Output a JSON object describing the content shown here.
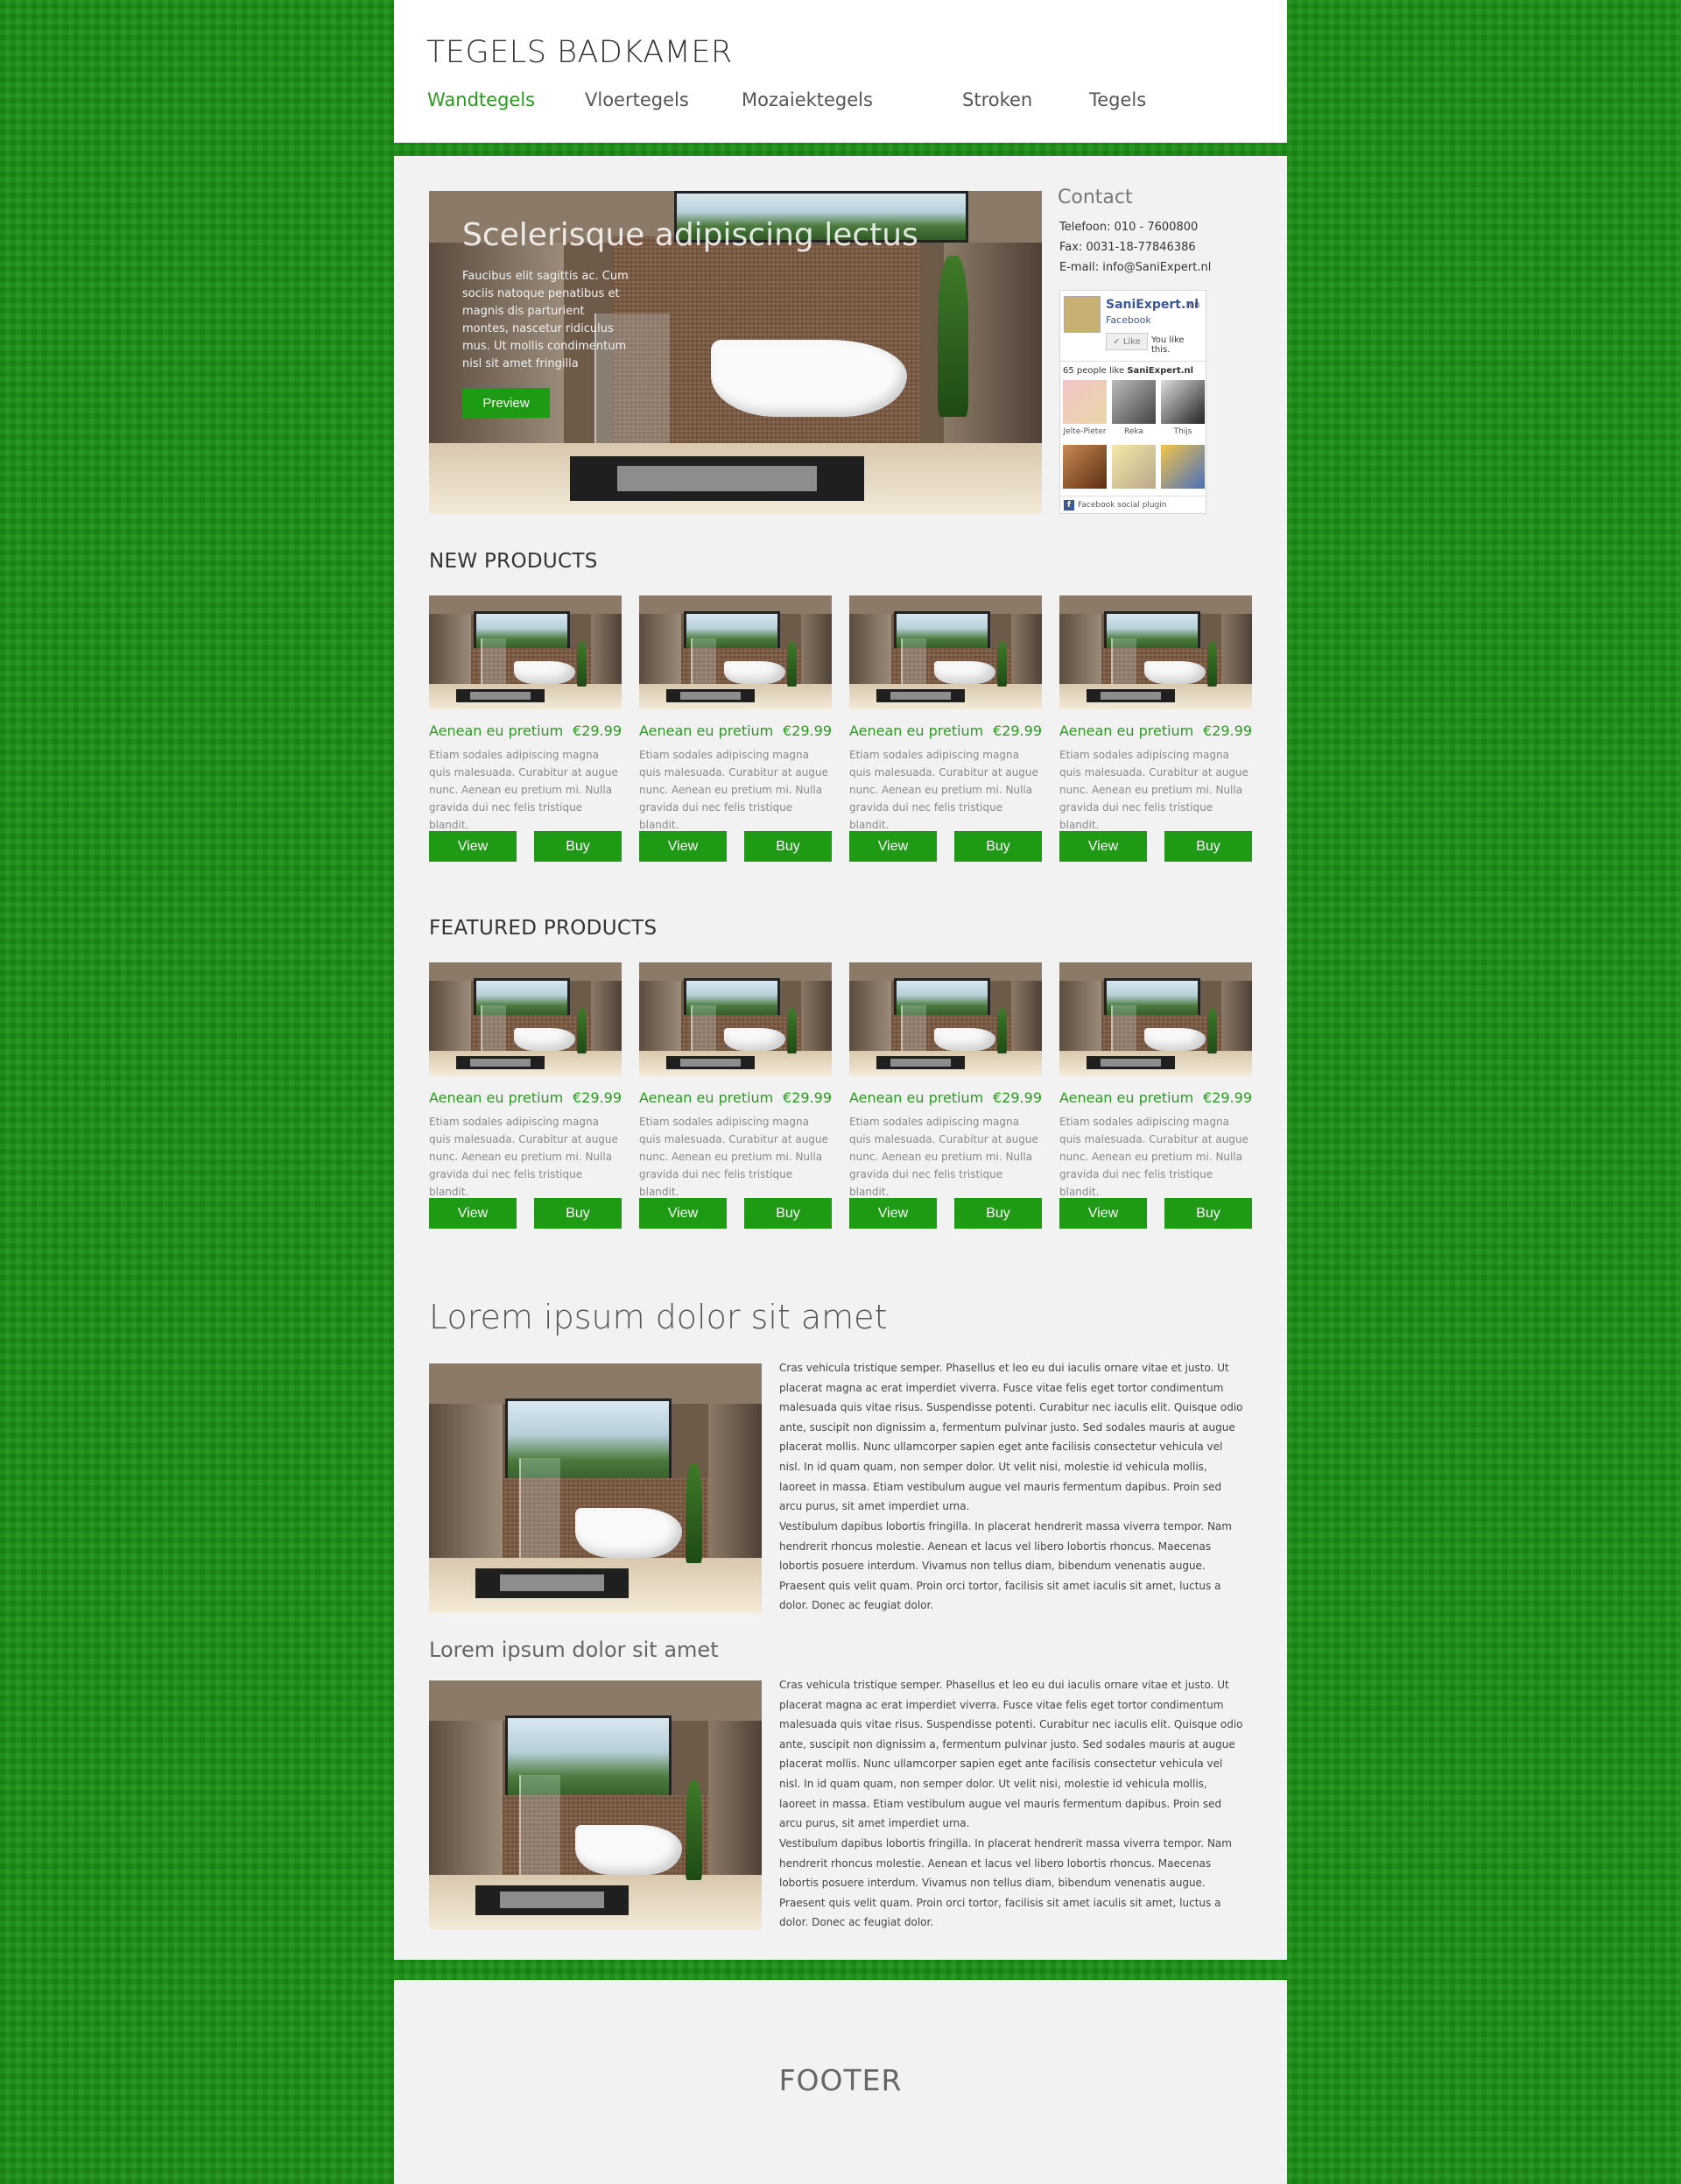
{
  "header": {
    "title": "TEGELS BADKAMER",
    "nav": [
      "Wandtegels",
      "Vloertegels",
      "Mozaiektegels",
      "Stroken",
      "Tegels"
    ]
  },
  "hero": {
    "title": "Scelerisque adipiscing lectus",
    "text": "Faucibus elit sagittis ac. Cum sociis natoque penatibus et magnis dis parturient montes, nascetur ridiculus mus. Ut mollis condimentum nisl sit amet fringilla",
    "button": "Preview"
  },
  "contact": {
    "title": "Contact",
    "phone": "Telefoon: 010 - 7600800",
    "fax": "Fax: 0031-18-77846386",
    "email": "E-mail: info@SaniExpert.nl"
  },
  "facebook": {
    "page_name": "SaniExpert.nl",
    "on_label": "on",
    "network": "Facebook",
    "like_button": "Like",
    "you_like": "You like this.",
    "count_prefix": "65 people like ",
    "count_name": "SaniExpert.nl",
    "people": [
      "Jelte-Pieter",
      "Reka",
      "Thijs",
      "",
      "",
      ""
    ],
    "plugin_label": "Facebook social plugin"
  },
  "new_products": {
    "title": "NEW PRODUCTS",
    "items": [
      {
        "name": "Aenean eu pretium",
        "price": "€29.99",
        "desc": "Etiam sodales adipiscing magna quis malesuada. Curabitur at augue nunc. Aenean eu pretium mi. Nulla gravida dui nec felis tristique blandit.",
        "view": "View",
        "buy": "Buy"
      },
      {
        "name": "Aenean eu pretium",
        "price": "€29.99",
        "desc": "Etiam sodales adipiscing magna quis malesuada. Curabitur at augue nunc. Aenean eu pretium mi. Nulla gravida dui nec felis tristique blandit.",
        "view": "View",
        "buy": "Buy"
      },
      {
        "name": "Aenean eu pretium",
        "price": "€29.99",
        "desc": "Etiam sodales adipiscing magna quis malesuada. Curabitur at augue nunc. Aenean eu pretium mi. Nulla gravida dui nec felis tristique blandit.",
        "view": "View",
        "buy": "Buy"
      },
      {
        "name": "Aenean eu pretium",
        "price": "€29.99",
        "desc": "Etiam sodales adipiscing magna quis malesuada. Curabitur at augue nunc. Aenean eu pretium mi. Nulla gravida dui nec felis tristique blandit.",
        "view": "View",
        "buy": "Buy"
      }
    ]
  },
  "featured_products": {
    "title": "FEATURED PRODUCTS",
    "items": [
      {
        "name": "Aenean eu pretium",
        "price": "€29.99",
        "desc": "Etiam sodales adipiscing magna quis malesuada. Curabitur at augue nunc. Aenean eu pretium mi. Nulla gravida dui nec felis tristique blandit.",
        "view": "View",
        "buy": "Buy"
      },
      {
        "name": "Aenean eu pretium",
        "price": "€29.99",
        "desc": "Etiam sodales adipiscing magna quis malesuada. Curabitur at augue nunc. Aenean eu pretium mi. Nulla gravida dui nec felis tristique blandit.",
        "view": "View",
        "buy": "Buy"
      },
      {
        "name": "Aenean eu pretium",
        "price": "€29.99",
        "desc": "Etiam sodales adipiscing magna quis malesuada. Curabitur at augue nunc. Aenean eu pretium mi. Nulla gravida dui nec felis tristique blandit.",
        "view": "View",
        "buy": "Buy"
      },
      {
        "name": "Aenean eu pretium",
        "price": "€29.99",
        "desc": "Etiam sodales adipiscing magna quis malesuada. Curabitur at augue nunc. Aenean eu pretium mi. Nulla gravida dui nec felis tristique blandit.",
        "view": "View",
        "buy": "Buy"
      }
    ]
  },
  "article": {
    "title": "Lorem ipsum dolor sit amet",
    "p1": "Cras vehicula tristique semper. Phasellus et leo eu dui iaculis ornare vitae et justo. Ut placerat magna ac erat imperdiet viverra. Fusce vitae felis eget tortor condimentum malesuada quis vitae risus. Suspendisse potenti. Curabitur nec iaculis elit. Quisque odio ante, suscipit non dignissim a, fermentum pulvinar justo. Sed sodales mauris at augue placerat mollis. Nunc ullamcorper sapien eget ante facilisis consectetur vehicula vel nisl. In id quam quam, non semper dolor. Ut velit nisi, molestie id vehicula mollis, laoreet in massa. Etiam vestibulum augue vel mauris fermentum dapibus. Proin sed arcu purus, sit amet imperdiet urna.",
    "p2": "Vestibulum dapibus lobortis fringilla. In placerat hendrerit massa viverra tempor. Nam hendrerit rhoncus molestie. Aenean et lacus vel libero lobortis rhoncus. Maecenas lobortis posuere interdum. Vivamus non tellus diam, bibendum venenatis augue. Praesent quis velit quam. Proin orci tortor, facilisis sit amet iaculis sit amet, luctus a dolor. Donec ac feugiat dolor.",
    "subtitle": "Lorem ipsum dolor sit amet",
    "p3": "Cras vehicula tristique semper. Phasellus et leo eu dui iaculis ornare vitae et justo. Ut placerat magna ac erat imperdiet viverra. Fusce vitae felis eget tortor condimentum malesuada quis vitae risus. Suspendisse potenti. Curabitur nec iaculis elit. Quisque odio ante, suscipit non dignissim a, fermentum pulvinar justo. Sed sodales mauris at augue placerat mollis. Nunc ullamcorper sapien eget ante facilisis consectetur vehicula vel nisl. In id quam quam, non semper dolor. Ut velit nisi, molestie id vehicula mollis, laoreet in massa. Etiam vestibulum augue vel mauris fermentum dapibus. Proin sed arcu purus, sit amet imperdiet urna.",
    "p4": "Vestibulum dapibus lobortis fringilla. In placerat hendrerit massa viverra tempor. Nam hendrerit rhoncus molestie. Aenean et lacus vel libero lobortis rhoncus. Maecenas lobortis posuere interdum. Vivamus non tellus diam, bibendum venenatis augue. Praesent quis velit quam. Proin orci tortor, facilisis sit amet iaculis sit amet, luctus a dolor. Donec ac feugiat dolor."
  },
  "footer": {
    "label": "FOOTER"
  },
  "colors": {
    "accent": "#1e9a14",
    "background": "#1a8f14",
    "panel": "#f2f2f2"
  }
}
